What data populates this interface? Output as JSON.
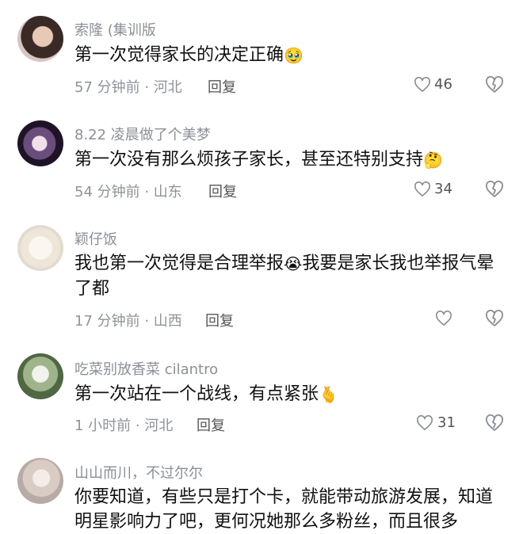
{
  "comments": [
    {
      "username": "索隆 (集训版",
      "text": "第一次觉得家长的决定正确",
      "emoji": "🥹",
      "time_location": "57 分钟前 · 河北",
      "reply_label": "回复",
      "likes": "46"
    },
    {
      "username": "8.22 凌晨做了个美梦",
      "text": "第一次没有那么烦孩子家长，甚至还特别支持",
      "emoji": "🤔",
      "time_location": "54 分钟前 · 山东",
      "reply_label": "回复",
      "likes": "34"
    },
    {
      "username": "颖仔饭",
      "text_part1": "我也第一次觉得是合理举报",
      "emoji": "😭",
      "text_part2": "我要是家长我也举报气晕了都",
      "time_location": "17 分钟前 · 山西",
      "reply_label": "回复",
      "likes": ""
    },
    {
      "username": "吃菜别放香菜 cilantro",
      "text": "第一次站在一个战线，有点紧张",
      "emoji": "🫰",
      "time_location": "1 小时前 · 河北",
      "reply_label": "回复",
      "likes": "31"
    },
    {
      "username": "山山而川，不过尔尔",
      "text": "你要知道，有些只是打个卡，就能带动旅游发展，知道明星影响力了吧，更何况她那么多粉丝，而且很多"
    }
  ],
  "icons": {
    "like": "heart-outline-icon",
    "dislike": "broken-heart-outline-icon"
  },
  "colors": {
    "meta_gray": "#8f939a",
    "text_black": "#111111",
    "icon_gray": "#8a8d92"
  }
}
